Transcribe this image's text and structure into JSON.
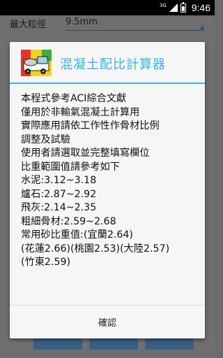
{
  "status_bar": {
    "network_type": "3G",
    "time": "9:46"
  },
  "background": {
    "field_label": "最大粒徑",
    "field_value": "9.5mm"
  },
  "dialog": {
    "title": "混凝土配比計算器",
    "icon": "truck-app-icon",
    "lines": [
      "本程式參考ACI綜合文獻",
      "僅用於非輸氣混凝土計算用",
      "實際應用請依工作性作骨材比例",
      "調整及試驗",
      "使用者請選取並完整填寫欄位",
      "比重範圍值請參考如下",
      "水泥:3.12~3.18",
      "爐石:2.87~2.92",
      "飛灰:2.14~2.35",
      "粗細骨材:2.59~2.68",
      "常用砂比重值:(宜蘭2.64)",
      "(花蓮2.66)(桃園2.53)(大陸2.57)",
      "(竹東2.59)"
    ],
    "confirm_label": "確認"
  },
  "colors": {
    "accent": "#33b5e5",
    "dim_background": "#6f6f6f",
    "dialog_background": "#f6f6f6"
  }
}
